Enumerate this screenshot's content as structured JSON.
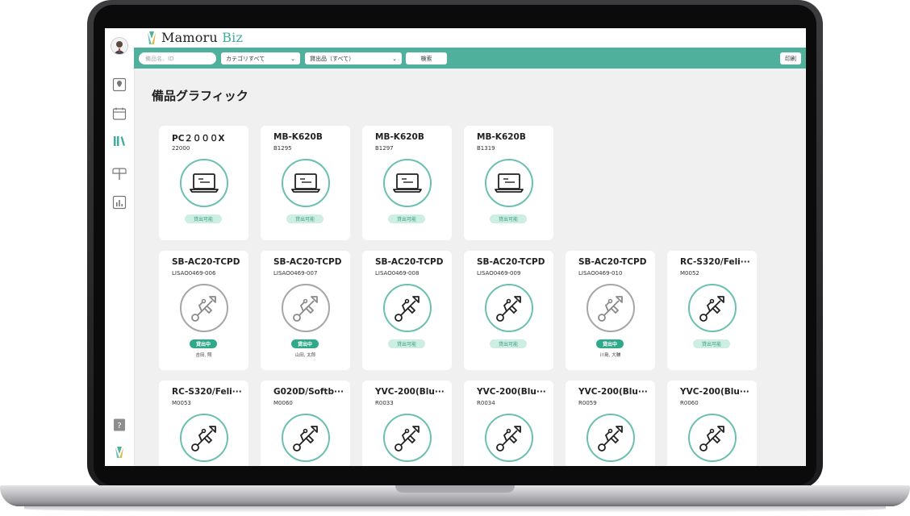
{
  "app": {
    "logo_text_main": "Mamoru",
    "logo_text_accent": "Biz"
  },
  "toolbar": {
    "search_placeholder": "備品名、ID",
    "category_select": "カテゴリすべて",
    "lending_select": "貸出品（すべて）",
    "search_button": "検索",
    "print_button": "印刷"
  },
  "page": {
    "title": "備品グラフィック"
  },
  "colors": {
    "accent": "#4fb19b",
    "ring_active": "#6cc0b0",
    "ring_inactive": "#a6a6a6",
    "badge_available_bg": "#cdeee3",
    "badge_lent_bg": "#2fa98a"
  },
  "sidebar": {
    "items": [
      {
        "icon": "map-icon"
      },
      {
        "icon": "calendar-icon"
      },
      {
        "icon": "books-icon",
        "active": true
      },
      {
        "icon": "mailbox-icon"
      },
      {
        "icon": "chart-icon"
      }
    ],
    "bottom": [
      {
        "icon": "help-icon"
      },
      {
        "icon": "logo-icon"
      }
    ]
  },
  "rows": [
    [
      {
        "name": "PC２０００X",
        "code": "22000",
        "icon": "laptop-icon",
        "status": "貸出可能"
      },
      {
        "name": "MB-K620B",
        "code": "B1295",
        "icon": "laptop-icon",
        "status": "貸出可能"
      },
      {
        "name": "MB-K620B",
        "code": "B1297",
        "icon": "laptop-icon",
        "status": "貸出可能"
      },
      {
        "name": "MB-K620B",
        "code": "B1319",
        "icon": "laptop-icon",
        "status": "貸出可能"
      }
    ],
    [
      {
        "name": "SB-AC20-TCPD",
        "code": "LISAO0469-006",
        "icon": "usb-icon",
        "status": "貸出中",
        "borrower": "吉田, 照",
        "lent": true
      },
      {
        "name": "SB-AC20-TCPD",
        "code": "LISAO0469-007",
        "icon": "usb-icon",
        "status": "貸出中",
        "borrower": "山田, 太郎",
        "lent": true
      },
      {
        "name": "SB-AC20-TCPD",
        "code": "LISAO0469-008",
        "icon": "usb-icon",
        "status": "貸出可能"
      },
      {
        "name": "SB-AC20-TCPD",
        "code": "LISAO0469-009",
        "icon": "usb-icon",
        "status": "貸出可能"
      },
      {
        "name": "SB-AC20-TCPD",
        "code": "LISAO0469-010",
        "icon": "usb-icon",
        "status": "貸出中",
        "borrower": "川島, 大輔",
        "lent": true
      },
      {
        "name": "RC-S320/Feli···",
        "code": "M0052",
        "icon": "usb-icon",
        "status": "貸出可能"
      }
    ],
    [
      {
        "name": "RC-S320/Feli···",
        "code": "M0053",
        "icon": "usb-icon"
      },
      {
        "name": "G020D/Softb···",
        "code": "M0060",
        "icon": "usb-icon"
      },
      {
        "name": "YVC-200(Blu···",
        "code": "R0033",
        "icon": "usb-icon"
      },
      {
        "name": "YVC-200(Blu···",
        "code": "R0034",
        "icon": "usb-icon"
      },
      {
        "name": "YVC-200(Blu···",
        "code": "R0059",
        "icon": "usb-icon"
      },
      {
        "name": "YVC-200(Blu···",
        "code": "R0060",
        "icon": "usb-icon"
      }
    ]
  ]
}
